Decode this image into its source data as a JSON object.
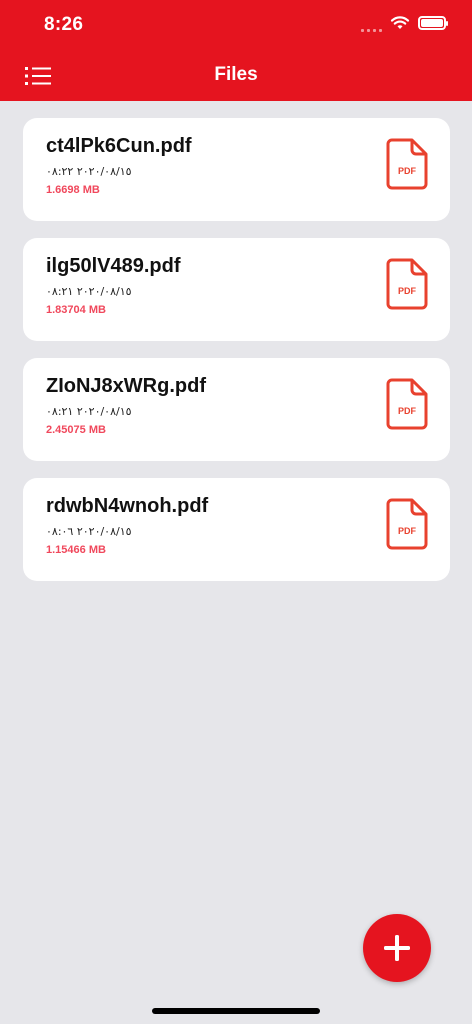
{
  "status_bar": {
    "time": "8:26"
  },
  "header": {
    "title": "Files"
  },
  "files": [
    {
      "name": "ct4lPk6Cun.pdf",
      "date": "٢٠٢٠/٠٨/١٥ ٠٨:٢٢",
      "size": "1.6698 MB"
    },
    {
      "name": "ilg50lV489.pdf",
      "date": "٢٠٢٠/٠٨/١٥ ٠٨:٢١",
      "size": "1.83704 MB"
    },
    {
      "name": "ZIoNJ8xWRg.pdf",
      "date": "٢٠٢٠/٠٨/١٥ ٠٨:٢١",
      "size": "2.45075 MB"
    },
    {
      "name": "rdwbN4wnoh.pdf",
      "date": "٢٠٢٠/٠٨/١٥ ٠٨:٠٦",
      "size": "1.15466 MB"
    }
  ],
  "file_icon": {
    "label": "PDF",
    "color": "#e8412e"
  },
  "fab": {
    "icon": "plus-icon"
  },
  "colors": {
    "accent": "#e5141f",
    "size_text": "#f0485c",
    "background": "#e6e6ea"
  }
}
